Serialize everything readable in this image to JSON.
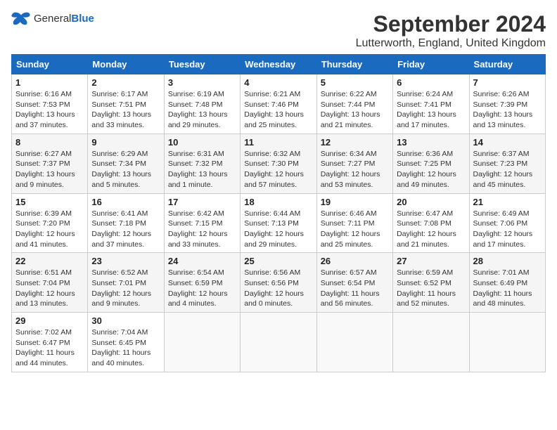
{
  "header": {
    "logo_general": "General",
    "logo_blue": "Blue",
    "title": "September 2024",
    "subtitle": "Lutterworth, England, United Kingdom"
  },
  "weekdays": [
    "Sunday",
    "Monday",
    "Tuesday",
    "Wednesday",
    "Thursday",
    "Friday",
    "Saturday"
  ],
  "weeks": [
    [
      {
        "day": "1",
        "info": "Sunrise: 6:16 AM\nSunset: 7:53 PM\nDaylight: 13 hours\nand 37 minutes."
      },
      {
        "day": "2",
        "info": "Sunrise: 6:17 AM\nSunset: 7:51 PM\nDaylight: 13 hours\nand 33 minutes."
      },
      {
        "day": "3",
        "info": "Sunrise: 6:19 AM\nSunset: 7:48 PM\nDaylight: 13 hours\nand 29 minutes."
      },
      {
        "day": "4",
        "info": "Sunrise: 6:21 AM\nSunset: 7:46 PM\nDaylight: 13 hours\nand 25 minutes."
      },
      {
        "day": "5",
        "info": "Sunrise: 6:22 AM\nSunset: 7:44 PM\nDaylight: 13 hours\nand 21 minutes."
      },
      {
        "day": "6",
        "info": "Sunrise: 6:24 AM\nSunset: 7:41 PM\nDaylight: 13 hours\nand 17 minutes."
      },
      {
        "day": "7",
        "info": "Sunrise: 6:26 AM\nSunset: 7:39 PM\nDaylight: 13 hours\nand 13 minutes."
      }
    ],
    [
      {
        "day": "8",
        "info": "Sunrise: 6:27 AM\nSunset: 7:37 PM\nDaylight: 13 hours\nand 9 minutes."
      },
      {
        "day": "9",
        "info": "Sunrise: 6:29 AM\nSunset: 7:34 PM\nDaylight: 13 hours\nand 5 minutes."
      },
      {
        "day": "10",
        "info": "Sunrise: 6:31 AM\nSunset: 7:32 PM\nDaylight: 13 hours\nand 1 minute."
      },
      {
        "day": "11",
        "info": "Sunrise: 6:32 AM\nSunset: 7:30 PM\nDaylight: 12 hours\nand 57 minutes."
      },
      {
        "day": "12",
        "info": "Sunrise: 6:34 AM\nSunset: 7:27 PM\nDaylight: 12 hours\nand 53 minutes."
      },
      {
        "day": "13",
        "info": "Sunrise: 6:36 AM\nSunset: 7:25 PM\nDaylight: 12 hours\nand 49 minutes."
      },
      {
        "day": "14",
        "info": "Sunrise: 6:37 AM\nSunset: 7:23 PM\nDaylight: 12 hours\nand 45 minutes."
      }
    ],
    [
      {
        "day": "15",
        "info": "Sunrise: 6:39 AM\nSunset: 7:20 PM\nDaylight: 12 hours\nand 41 minutes."
      },
      {
        "day": "16",
        "info": "Sunrise: 6:41 AM\nSunset: 7:18 PM\nDaylight: 12 hours\nand 37 minutes."
      },
      {
        "day": "17",
        "info": "Sunrise: 6:42 AM\nSunset: 7:15 PM\nDaylight: 12 hours\nand 33 minutes."
      },
      {
        "day": "18",
        "info": "Sunrise: 6:44 AM\nSunset: 7:13 PM\nDaylight: 12 hours\nand 29 minutes."
      },
      {
        "day": "19",
        "info": "Sunrise: 6:46 AM\nSunset: 7:11 PM\nDaylight: 12 hours\nand 25 minutes."
      },
      {
        "day": "20",
        "info": "Sunrise: 6:47 AM\nSunset: 7:08 PM\nDaylight: 12 hours\nand 21 minutes."
      },
      {
        "day": "21",
        "info": "Sunrise: 6:49 AM\nSunset: 7:06 PM\nDaylight: 12 hours\nand 17 minutes."
      }
    ],
    [
      {
        "day": "22",
        "info": "Sunrise: 6:51 AM\nSunset: 7:04 PM\nDaylight: 12 hours\nand 13 minutes."
      },
      {
        "day": "23",
        "info": "Sunrise: 6:52 AM\nSunset: 7:01 PM\nDaylight: 12 hours\nand 9 minutes."
      },
      {
        "day": "24",
        "info": "Sunrise: 6:54 AM\nSunset: 6:59 PM\nDaylight: 12 hours\nand 4 minutes."
      },
      {
        "day": "25",
        "info": "Sunrise: 6:56 AM\nSunset: 6:56 PM\nDaylight: 12 hours\nand 0 minutes."
      },
      {
        "day": "26",
        "info": "Sunrise: 6:57 AM\nSunset: 6:54 PM\nDaylight: 11 hours\nand 56 minutes."
      },
      {
        "day": "27",
        "info": "Sunrise: 6:59 AM\nSunset: 6:52 PM\nDaylight: 11 hours\nand 52 minutes."
      },
      {
        "day": "28",
        "info": "Sunrise: 7:01 AM\nSunset: 6:49 PM\nDaylight: 11 hours\nand 48 minutes."
      }
    ],
    [
      {
        "day": "29",
        "info": "Sunrise: 7:02 AM\nSunset: 6:47 PM\nDaylight: 11 hours\nand 44 minutes."
      },
      {
        "day": "30",
        "info": "Sunrise: 7:04 AM\nSunset: 6:45 PM\nDaylight: 11 hours\nand 40 minutes."
      },
      {
        "day": "",
        "info": ""
      },
      {
        "day": "",
        "info": ""
      },
      {
        "day": "",
        "info": ""
      },
      {
        "day": "",
        "info": ""
      },
      {
        "day": "",
        "info": ""
      }
    ]
  ]
}
